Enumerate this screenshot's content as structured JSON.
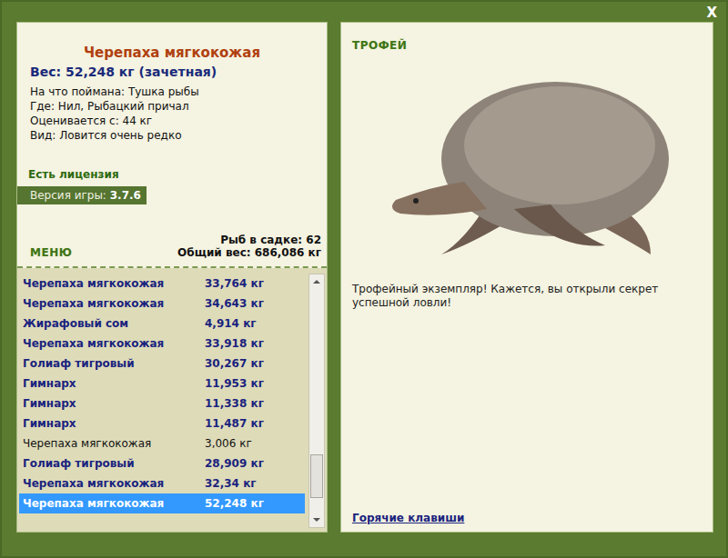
{
  "window": {
    "close": "X"
  },
  "catch": {
    "title": "Черепаха мягкокожая",
    "weight": "Вес: 52,248 кг (зачетная)",
    "details": [
      "На что поймана: Тушка рыбы",
      "Где: Нил, Рыбацкий причал",
      "Оценивается с: 44 кг",
      "Вид: Ловится очень редко"
    ],
    "license": "Есть лицензия"
  },
  "version": {
    "label": "Версия игры: ",
    "value": "3.7.6"
  },
  "menu": {
    "label": "МЕНЮ"
  },
  "keepnet": {
    "count": "Рыб в садке: 62",
    "total": "Общий вес: 686,086 кг"
  },
  "list": {
    "rows": [
      {
        "name": "Черепаха мягкокожая",
        "weight": "33,764 кг",
        "counted": true,
        "selected": false
      },
      {
        "name": "Черепаха мягкокожая",
        "weight": "34,643 кг",
        "counted": true,
        "selected": false
      },
      {
        "name": "Жирафовый сом",
        "weight": "4,914 кг",
        "counted": true,
        "selected": false
      },
      {
        "name": "Черепаха мягкокожая",
        "weight": "33,918 кг",
        "counted": true,
        "selected": false
      },
      {
        "name": "Голиаф тигровый",
        "weight": "30,267 кг",
        "counted": true,
        "selected": false
      },
      {
        "name": "Гимнарх",
        "weight": "11,953 кг",
        "counted": true,
        "selected": false
      },
      {
        "name": "Гимнарх",
        "weight": "11,338 кг",
        "counted": true,
        "selected": false
      },
      {
        "name": "Гимнарх",
        "weight": "11,487 кг",
        "counted": true,
        "selected": false
      },
      {
        "name": "Черепаха мягкокожая",
        "weight": "3,006 кг",
        "counted": false,
        "selected": false
      },
      {
        "name": "Голиаф тигровый",
        "weight": "28,909 кг",
        "counted": true,
        "selected": false
      },
      {
        "name": "Черепаха мягкокожая",
        "weight": "32,34 кг",
        "counted": true,
        "selected": false
      },
      {
        "name": "Черепаха мягкокожая",
        "weight": "52,248 кг",
        "counted": true,
        "selected": true
      }
    ],
    "scrollbar": {
      "level": 0.92
    }
  },
  "trophy": {
    "label": "ТРОФЕЙ",
    "text": "Трофейный экземпляр! Кажется, вы открыли секрет успешной ловли!"
  },
  "hotkeys": {
    "label": "Горячие клавиши"
  }
}
